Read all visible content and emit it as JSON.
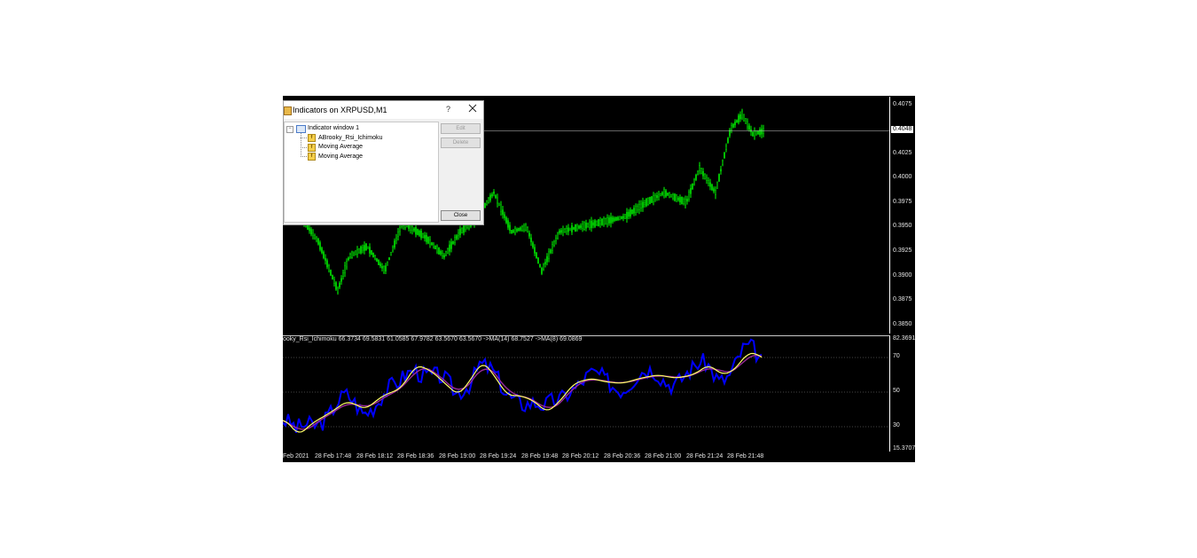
{
  "dialog": {
    "title": "Indicators on XRPUSD,M1",
    "help_label": "?",
    "close_icon": "close-icon",
    "tree": {
      "root": "Indicator window 1",
      "items": [
        "ABrooky_Rsi_Ichimoku",
        "Moving Average",
        "Moving Average"
      ]
    },
    "buttons": {
      "edit": "Edit",
      "delete": "Delete",
      "close": "Close"
    }
  },
  "chart": {
    "symbol": "XRPUSD",
    "timeframe": "M1",
    "price_axis": [
      "0.4075",
      "0.4025",
      "0.4000",
      "0.3975",
      "0.3950",
      "0.3925",
      "0.3900",
      "0.3875",
      "0.3850"
    ],
    "current_price": "0.4048",
    "indicator_info": "ooky_Rsi_Ichimoku 66.3734 69.5831 61.0585 67.9782 63.5670 63.5670  ->MA(14) 68.7527  ->MA(8) 69.0869",
    "indicator_axis": {
      "max": "82.3691",
      "levels": [
        "70",
        "50",
        "30"
      ],
      "min": "15.3707"
    },
    "time_axis": [
      "Feb 2021",
      "28 Feb 17:48",
      "28 Feb 18:12",
      "28 Feb 18:36",
      "28 Feb 19:00",
      "28 Feb 19:24",
      "28 Feb 19:48",
      "28 Feb 20:12",
      "28 Feb 20:36",
      "28 Feb 21:00",
      "28 Feb 21:24",
      "28 Feb 21:48"
    ],
    "colors": {
      "bull": "#00ff00",
      "rsi": "#0000ff",
      "ma_fast": "#ffff66",
      "ma_slow": "#9a2a9a"
    }
  }
}
